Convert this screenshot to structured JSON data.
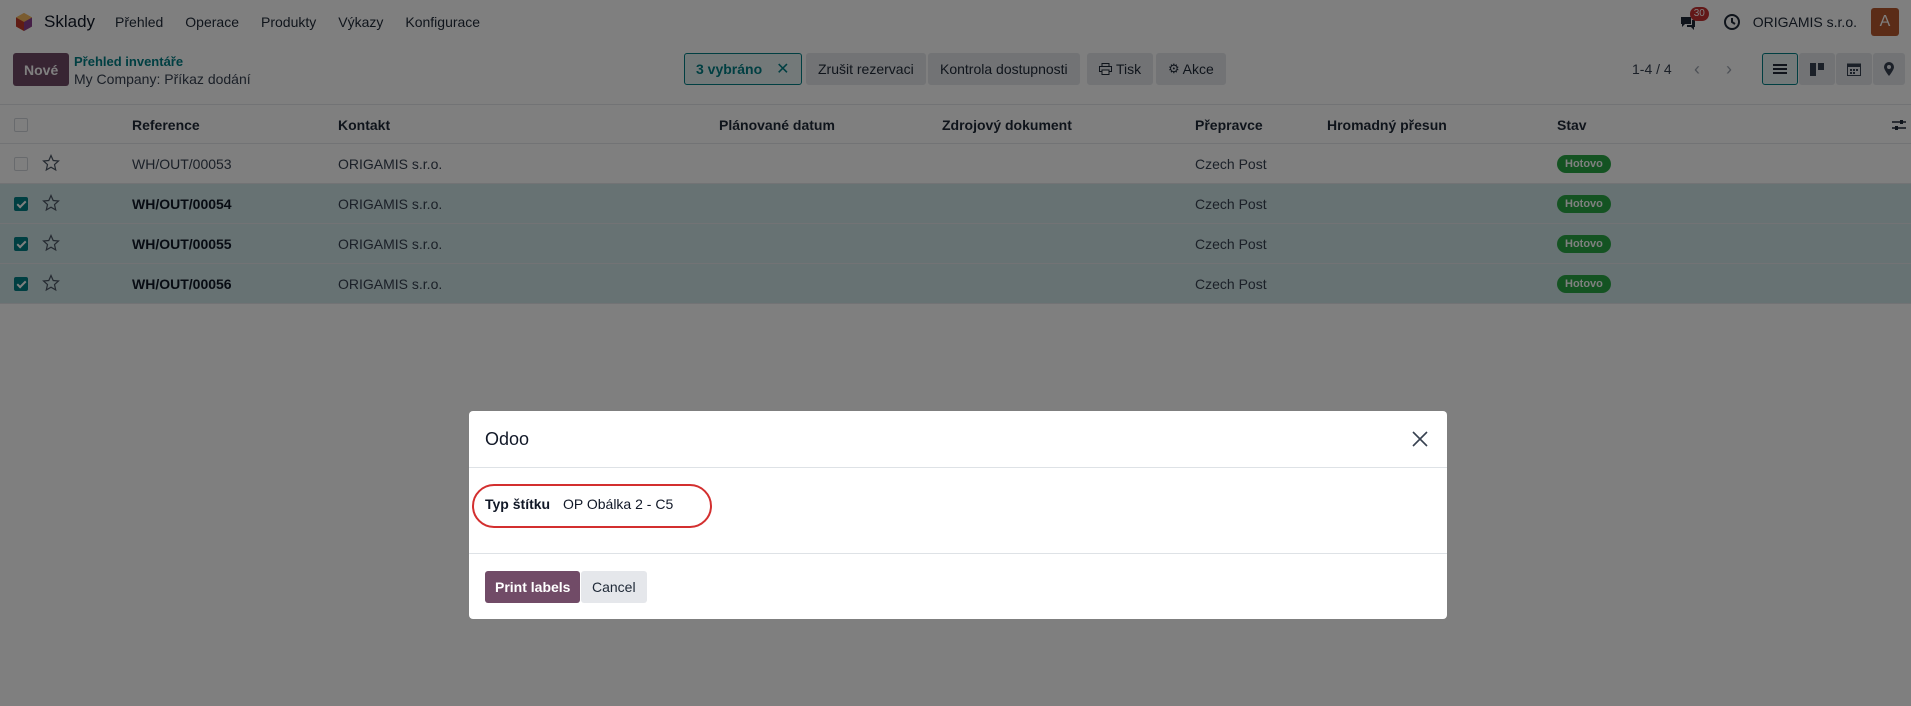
{
  "navbar": {
    "app_name": "Sklady",
    "menu": [
      "Přehled",
      "Operace",
      "Produkty",
      "Výkazy",
      "Konfigurace"
    ],
    "chat_count": "30",
    "company": "ORIGAMIS s.r.o.",
    "avatar_letter": "A"
  },
  "control": {
    "new_label": "Nové",
    "breadcrumb_parent": "Přehled inventáře",
    "breadcrumb_current": "My Company: Příkaz dodání",
    "selected_label": "3 vybráno",
    "unreserve_label": "Zrušit rezervaci",
    "check_availability_label": "Kontrola dostupnosti",
    "print_label": "Tisk",
    "actions_label": "Akce",
    "pager": "1-4 / 4"
  },
  "table": {
    "headers": {
      "reference": "Reference",
      "contact": "Kontakt",
      "scheduled_date": "Plánované datum",
      "source_document": "Zdrojový dokument",
      "carrier": "Přepravce",
      "batch_transfer": "Hromadný přesun",
      "status": "Stav"
    },
    "rows": [
      {
        "reference": "WH/OUT/00053",
        "contact": "ORIGAMIS s.r.o.",
        "carrier": "Czech Post",
        "status": "Hotovo",
        "selected": false
      },
      {
        "reference": "WH/OUT/00054",
        "contact": "ORIGAMIS s.r.o.",
        "carrier": "Czech Post",
        "status": "Hotovo",
        "selected": true
      },
      {
        "reference": "WH/OUT/00055",
        "contact": "ORIGAMIS s.r.o.",
        "carrier": "Czech Post",
        "status": "Hotovo",
        "selected": true
      },
      {
        "reference": "WH/OUT/00056",
        "contact": "ORIGAMIS s.r.o.",
        "carrier": "Czech Post",
        "status": "Hotovo",
        "selected": true
      }
    ]
  },
  "modal": {
    "title": "Odoo",
    "field_label": "Typ štítku",
    "field_value": "OP Obálka 2 - C5",
    "print_button": "Print labels",
    "cancel_button": "Cancel"
  },
  "colors": {
    "brand": "#714b67",
    "accent": "#017e84",
    "success": "#28a745",
    "highlight": "#d32f2f"
  }
}
